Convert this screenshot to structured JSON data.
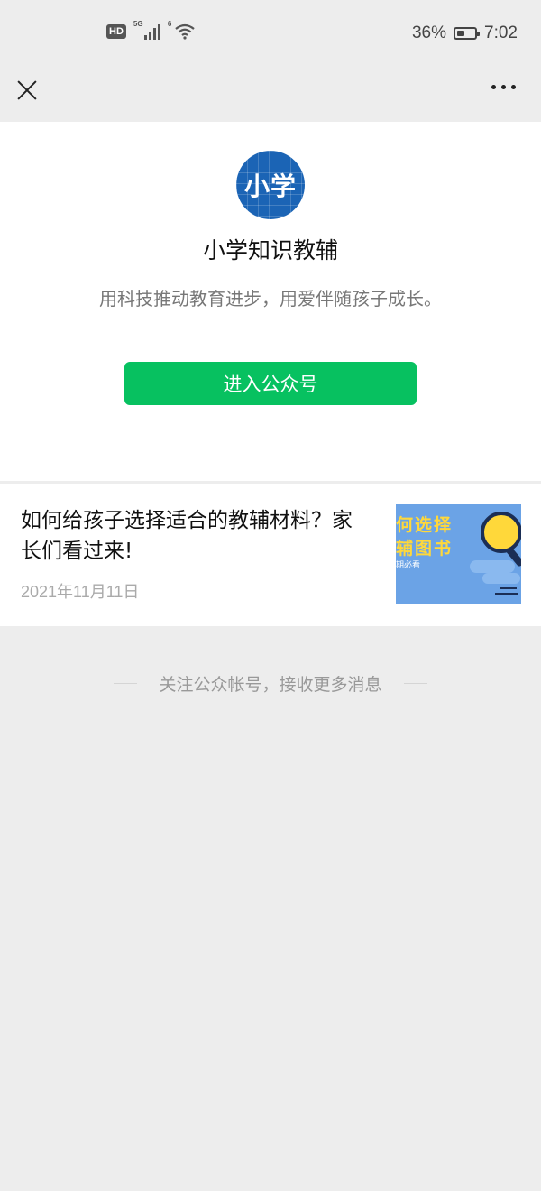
{
  "status_bar": {
    "hd": "HD",
    "signal_1_tag": "5G",
    "signal_2_tag": "6",
    "battery_percent": "36%",
    "time": "7:02",
    "battery_level": 0.36
  },
  "nav": {
    "close_icon": "close-icon",
    "more_icon": "more-icon"
  },
  "profile": {
    "avatar_text": "小学",
    "name": "小学知识教辅",
    "description": "用科技推动教育进步，用爱伴随孩子成长。",
    "enter_button": "进入公众号",
    "enter_button_color": "#07c160",
    "avatar_color": "#1b64b5"
  },
  "article": {
    "title": "如何给孩子选择适合的教辅材料？家长们看过来!",
    "date": "2021年11月11日",
    "thumbnail": {
      "line1": "何选择",
      "line2": "辅图书",
      "line3": "期必看"
    }
  },
  "footer": {
    "note": "关注公众帐号，接收更多消息"
  }
}
